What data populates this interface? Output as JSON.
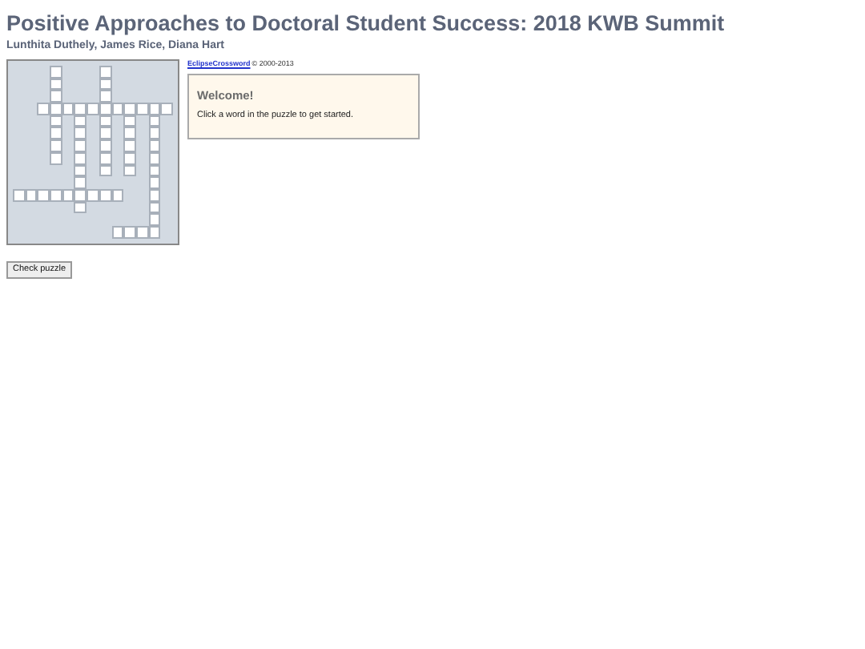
{
  "title": "Positive Approaches to Doctoral Student Success: 2018 KWB Summit",
  "authors": "Lunthita Duthely, James Rice, Diana Hart",
  "puzzle": {
    "grid": [
      [
        {
          "open": false
        },
        {
          "open": false
        },
        {
          "open": false
        },
        {
          "open": true
        },
        {
          "open": false
        },
        {
          "open": false
        },
        {
          "open": false
        },
        {
          "open": true
        },
        {
          "open": false
        },
        {
          "open": false
        },
        {
          "open": false
        },
        {
          "open": false
        },
        {
          "open": false
        }
      ],
      [
        {
          "open": false
        },
        {
          "open": false
        },
        {
          "open": false
        },
        {
          "open": true
        },
        {
          "open": false
        },
        {
          "open": false
        },
        {
          "open": false
        },
        {
          "open": true
        },
        {
          "open": false
        },
        {
          "open": false
        },
        {
          "open": false
        },
        {
          "open": false
        },
        {
          "open": false
        }
      ],
      [
        {
          "open": false
        },
        {
          "open": false
        },
        {
          "open": false
        },
        {
          "open": true
        },
        {
          "open": false
        },
        {
          "open": false
        },
        {
          "open": false
        },
        {
          "open": true
        },
        {
          "open": false
        },
        {
          "open": false
        },
        {
          "open": false
        },
        {
          "open": false
        },
        {
          "open": false
        }
      ],
      [
        {
          "open": false
        },
        {
          "open": false
        },
        {
          "open": true
        },
        {
          "open": true
        },
        {
          "open": true
        },
        {
          "open": true
        },
        {
          "open": true
        },
        {
          "open": true
        },
        {
          "open": true
        },
        {
          "open": true
        },
        {
          "open": true
        },
        {
          "open": true
        },
        {
          "open": true
        }
      ],
      [
        {
          "open": false
        },
        {
          "open": false
        },
        {
          "open": false
        },
        {
          "open": true
        },
        {
          "open": false
        },
        {
          "open": true
        },
        {
          "open": false
        },
        {
          "open": true
        },
        {
          "open": false
        },
        {
          "open": true
        },
        {
          "open": false
        },
        {
          "open": true
        },
        {
          "open": false
        }
      ],
      [
        {
          "open": false
        },
        {
          "open": false
        },
        {
          "open": false
        },
        {
          "open": true
        },
        {
          "open": false
        },
        {
          "open": true
        },
        {
          "open": false
        },
        {
          "open": true
        },
        {
          "open": false
        },
        {
          "open": true
        },
        {
          "open": false
        },
        {
          "open": true
        },
        {
          "open": false
        }
      ],
      [
        {
          "open": false
        },
        {
          "open": false
        },
        {
          "open": false
        },
        {
          "open": true
        },
        {
          "open": false
        },
        {
          "open": true
        },
        {
          "open": false
        },
        {
          "open": true
        },
        {
          "open": false
        },
        {
          "open": true
        },
        {
          "open": false
        },
        {
          "open": true
        },
        {
          "open": false
        }
      ],
      [
        {
          "open": false
        },
        {
          "open": false
        },
        {
          "open": false
        },
        {
          "open": true
        },
        {
          "open": false
        },
        {
          "open": true
        },
        {
          "open": false
        },
        {
          "open": true
        },
        {
          "open": false
        },
        {
          "open": true
        },
        {
          "open": false
        },
        {
          "open": true
        },
        {
          "open": false
        }
      ],
      [
        {
          "open": false
        },
        {
          "open": false
        },
        {
          "open": false
        },
        {
          "open": false
        },
        {
          "open": false
        },
        {
          "open": true
        },
        {
          "open": false
        },
        {
          "open": true
        },
        {
          "open": false
        },
        {
          "open": true
        },
        {
          "open": false
        },
        {
          "open": true
        },
        {
          "open": false
        }
      ],
      [
        {
          "open": false
        },
        {
          "open": false
        },
        {
          "open": false
        },
        {
          "open": false
        },
        {
          "open": false
        },
        {
          "open": true
        },
        {
          "open": false
        },
        {
          "open": false
        },
        {
          "open": false
        },
        {
          "open": false
        },
        {
          "open": false
        },
        {
          "open": true
        },
        {
          "open": false
        }
      ],
      [
        {
          "open": true
        },
        {
          "open": true
        },
        {
          "open": true
        },
        {
          "open": true
        },
        {
          "open": true
        },
        {
          "open": true
        },
        {
          "open": true
        },
        {
          "open": true
        },
        {
          "open": true
        },
        {
          "open": false
        },
        {
          "open": false
        },
        {
          "open": true
        },
        {
          "open": false
        }
      ],
      [
        {
          "open": false
        },
        {
          "open": false
        },
        {
          "open": false
        },
        {
          "open": false
        },
        {
          "open": false
        },
        {
          "open": true
        },
        {
          "open": false
        },
        {
          "open": false
        },
        {
          "open": false
        },
        {
          "open": false
        },
        {
          "open": false
        },
        {
          "open": true
        },
        {
          "open": false
        }
      ],
      [
        {
          "open": false
        },
        {
          "open": false
        },
        {
          "open": false
        },
        {
          "open": false
        },
        {
          "open": false
        },
        {
          "open": false
        },
        {
          "open": false
        },
        {
          "open": false
        },
        {
          "open": false
        },
        {
          "open": false
        },
        {
          "open": false
        },
        {
          "open": true
        },
        {
          "open": false
        }
      ],
      [
        {
          "open": false
        },
        {
          "open": false
        },
        {
          "open": false
        },
        {
          "open": false
        },
        {
          "open": false
        },
        {
          "open": false
        },
        {
          "open": false
        },
        {
          "open": false
        },
        {
          "open": true
        },
        {
          "open": true
        },
        {
          "open": true
        },
        {
          "open": true
        },
        {
          "open": false
        }
      ]
    ]
  },
  "credit": {
    "link": "EclipseCrossword",
    "copyright": "© 2000-2013"
  },
  "welcome": {
    "heading": "Welcome!",
    "text": "Click a word in the puzzle to get started."
  },
  "check_button": "Check puzzle"
}
